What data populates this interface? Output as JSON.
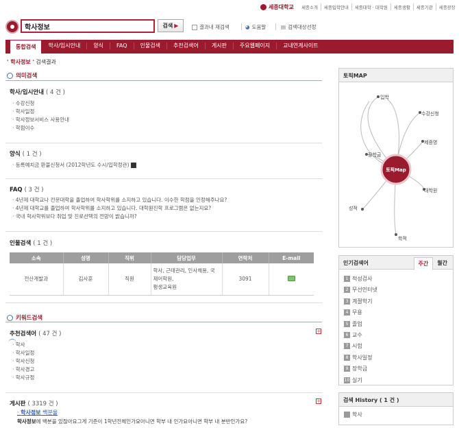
{
  "top": {
    "university": "세종대학교",
    "links": [
      "세종소개",
      "세종입학안내",
      "세종대학 · 대학원",
      "세종생활",
      "세종기관",
      "세종광장"
    ]
  },
  "search": {
    "query": "학사정보",
    "button": "검색",
    "options": [
      "결과내 재검색",
      "도움말",
      "검색대상선정"
    ]
  },
  "nav": {
    "tabs": [
      "통합검색",
      "학사/입시안내",
      "양식",
      "FAQ",
      "인물검색",
      "추천검색어",
      "게시판",
      "주요웹페이지",
      "교내연계사이트"
    ]
  },
  "breadcrumb": {
    "term": "' 학사정보 '",
    "suffix": " 검색결과"
  },
  "semantic": {
    "header": "의미검색",
    "groups": [
      {
        "title": "학사/입시안내",
        "count": "( 4 건 )",
        "items": [
          "수강신청",
          "학사일정",
          "학사정보서비스 사용안내",
          "학점이수"
        ]
      },
      {
        "title": "양식",
        "count": "( 1 건 )",
        "items": [
          "등록예치금 환불신청서 (2012학년도 수시/입학정관)"
        ]
      },
      {
        "title": "FAQ",
        "count": "( 3 건 )",
        "items": [
          "4년제 대학교나 전문대학을 졸업하여 학사학위를 소지하고 있습니다. 이수한 학점을 인정해주나요?",
          "4년제 대학교를 졸업하여 학사학위를 소지하고 있습니다. 대학원진학 프로그램은 없는지요?",
          "국내 학사학위보다 취업 및 진로선택의 전망이 밝습니까?"
        ]
      }
    ],
    "person": {
      "title": "인물검색",
      "count": "( 1 건 )",
      "columns": [
        "소속",
        "성명",
        "직위",
        "담당업무",
        "연락처",
        "E-mail"
      ],
      "row": {
        "dept": "전산개발과",
        "name": "김사훈",
        "position": "직원",
        "duty_line1": "학사, 근태관리, 인사채용, 국제어학원,",
        "duty_line2": "평생교육원",
        "phone": "3091"
      }
    }
  },
  "keyword": {
    "header": "키워드검색",
    "recommend": {
      "title": "추천검색어",
      "count": "( 47 건 )",
      "items": [
        "학사",
        "학사일정",
        "학사신청",
        "학사경고",
        "학사규정"
      ]
    },
    "board": {
      "title": "게시판",
      "count": "( 3319 건 )",
      "post_bold": "학사정보",
      "post_rest": " 백분율",
      "snippet_bold": "학사정보",
      "snippet_rest": "에 백분을 있잖아요그게 기준이 1학년전체인가요아니면 학부 내 인가요아니면 학부 내 분반인가요?"
    }
  },
  "sidebar": {
    "topic_map": {
      "title": "토픽MAP",
      "center": "토픽Map",
      "nodes": [
        "입학",
        "수강신청",
        "장학금",
        "제증명",
        "대학원",
        "성적",
        "학적"
      ]
    },
    "popular": {
      "title": "인기검색어",
      "tabs": [
        "주간",
        "월간"
      ],
      "items": [
        "적성검사",
        "무선인터넷",
        "계절학기",
        "무용",
        "졸업",
        "교수",
        "시험",
        "학사일정",
        "장학금",
        "실기"
      ]
    },
    "history": {
      "title": "검색 History",
      "count": "( 1 건 )",
      "items": [
        "학사"
      ]
    }
  },
  "colors": {
    "brand": "#9b1b2e",
    "accent": "#b41f35",
    "link": "#2a5db0"
  }
}
